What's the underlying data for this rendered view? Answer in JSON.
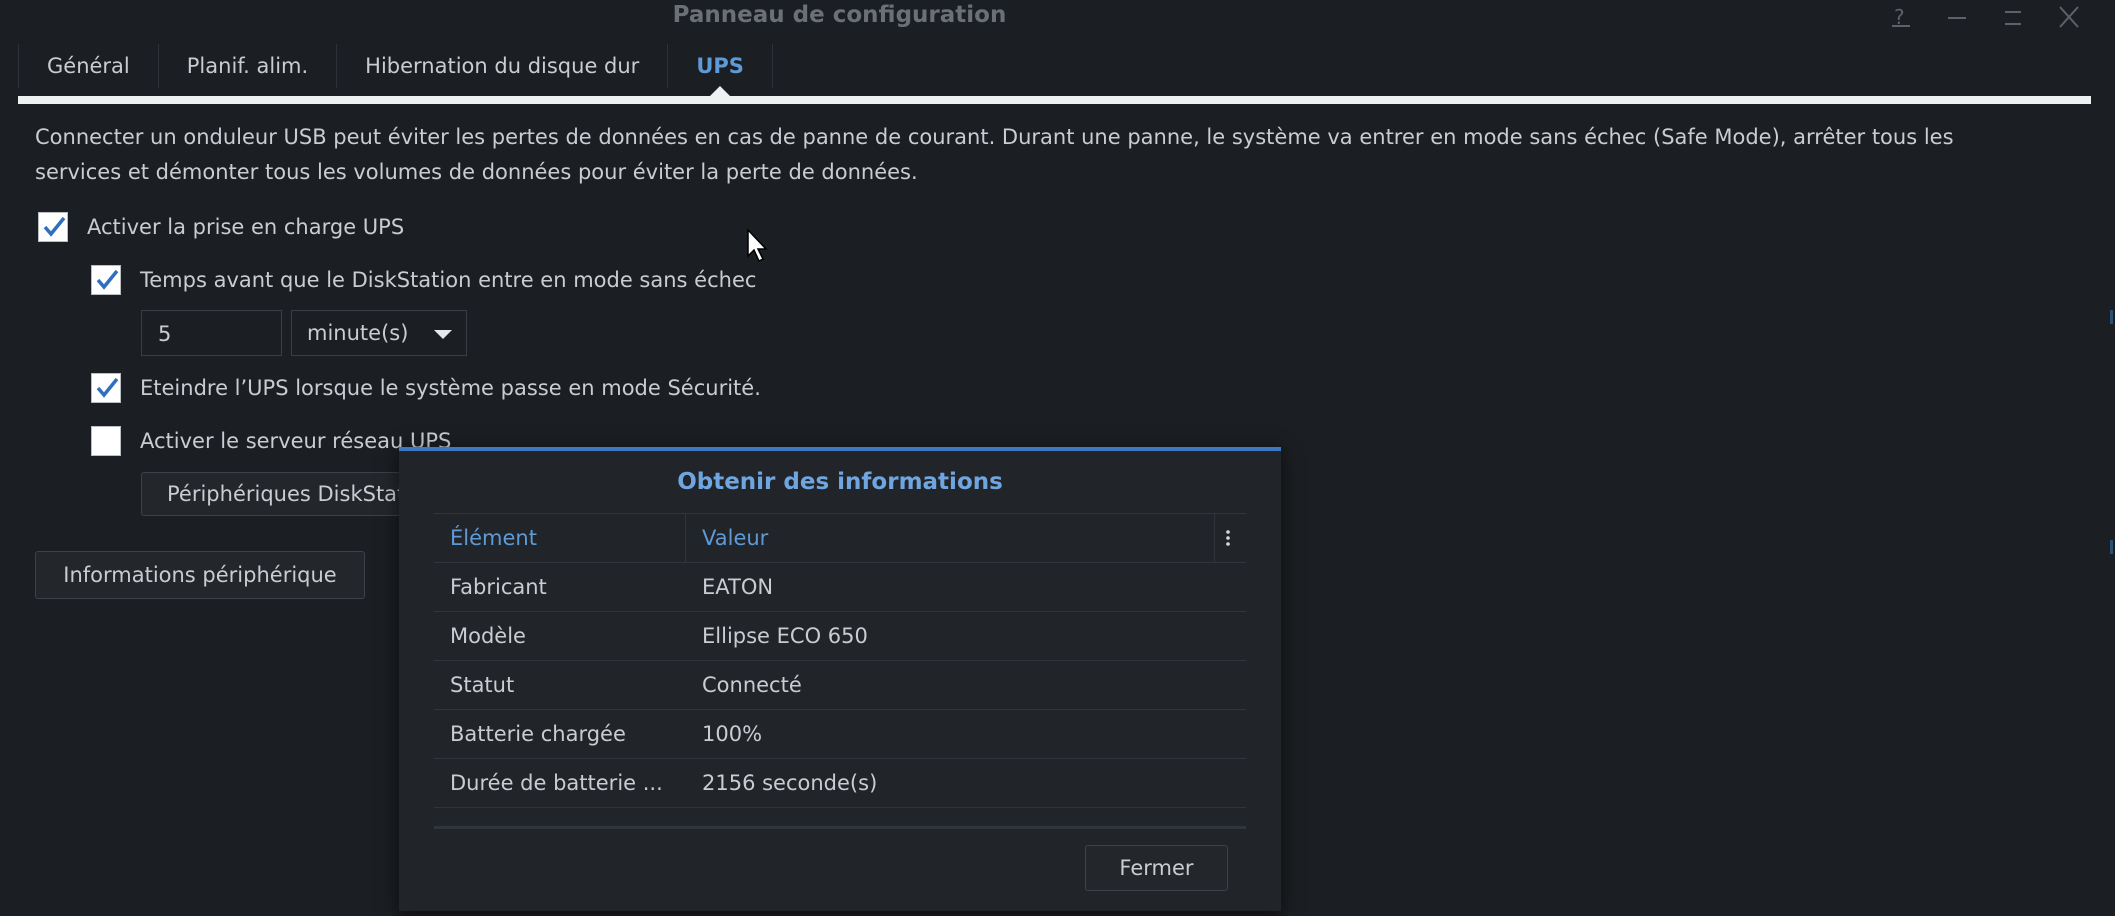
{
  "window": {
    "title": "Panneau de configuration",
    "controls": [
      "help-icon",
      "minimize-icon",
      "maximize-icon",
      "close-icon"
    ]
  },
  "tabs": [
    {
      "label": "Général",
      "active": false
    },
    {
      "label": "Planif. alim.",
      "active": false
    },
    {
      "label": "Hibernation du disque dur",
      "active": false
    },
    {
      "label": "UPS",
      "active": true
    }
  ],
  "ups": {
    "description": "Connecter un onduleur USB peut éviter les pertes de données en cas de panne de courant. Durant une panne, le système va entrer en mode sans échec (Safe Mode), arrêter tous les services et démonter tous les volumes de données pour éviter la perte de données.",
    "enable_ups": {
      "label": "Activer la prise en charge UPS",
      "checked": true
    },
    "safe_mode_delay": {
      "label": "Temps avant que le DiskStation entre en mode sans échec",
      "checked": true
    },
    "delay_value": "5",
    "delay_unit": "minute(s)",
    "shutdown_ups": {
      "label": "Eteindre l’UPS lorsque le système passe en mode Sécurité.",
      "checked": true
    },
    "network_server": {
      "label": "Activer le serveur réseau UPS",
      "checked": false
    },
    "permitted_devices_button": "Périphériques DiskStation autorisés",
    "device_info_button": "Informations périphérique"
  },
  "dialog": {
    "title": "Obtenir des informations",
    "columns": [
      "Élément",
      "Valeur"
    ],
    "rows": [
      {
        "item": "Fabricant",
        "value": "EATON"
      },
      {
        "item": "Modèle",
        "value": "Ellipse ECO 650"
      },
      {
        "item": "Statut",
        "value": "Connecté"
      },
      {
        "item": "Batterie chargée",
        "value": "100%"
      },
      {
        "item": "Durée de batterie ...",
        "value": "2156 seconde(s)"
      }
    ],
    "close_button": "Fermer"
  },
  "colors": {
    "background": "#1b1e22",
    "accent": "#5e9bd6",
    "dialog_border": "#3a78c2",
    "text": "#c9cdd2"
  }
}
